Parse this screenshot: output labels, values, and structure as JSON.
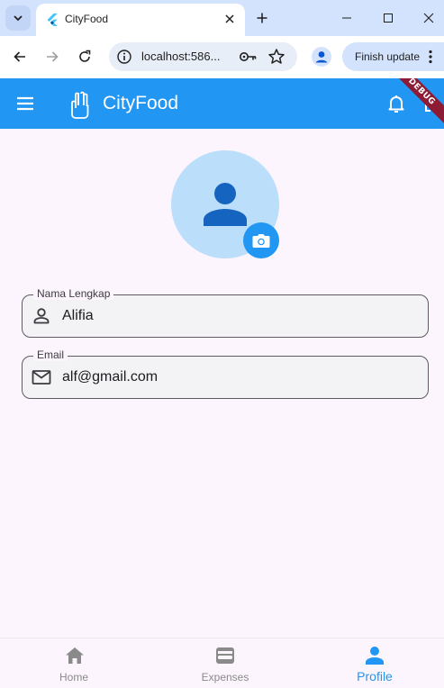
{
  "browser": {
    "tab_title": "CityFood",
    "url": "localhost:586...",
    "finish_update_label": "Finish update"
  },
  "app": {
    "title": "CityFood",
    "debug_banner": "DEBUG",
    "primary_color": "#2196f3"
  },
  "profile": {
    "fields": [
      {
        "label": "Nama Lengkap",
        "value": "Alifia",
        "icon": "person-outline-icon"
      },
      {
        "label": "Email",
        "value": "alf@gmail.com",
        "icon": "mail-outline-icon"
      }
    ]
  },
  "bottom_nav": {
    "items": [
      {
        "label": "Home",
        "icon": "home-icon",
        "active": false
      },
      {
        "label": "Expenses",
        "icon": "wallet-icon",
        "active": false
      },
      {
        "label": "Profile",
        "icon": "person-icon",
        "active": true
      }
    ]
  }
}
